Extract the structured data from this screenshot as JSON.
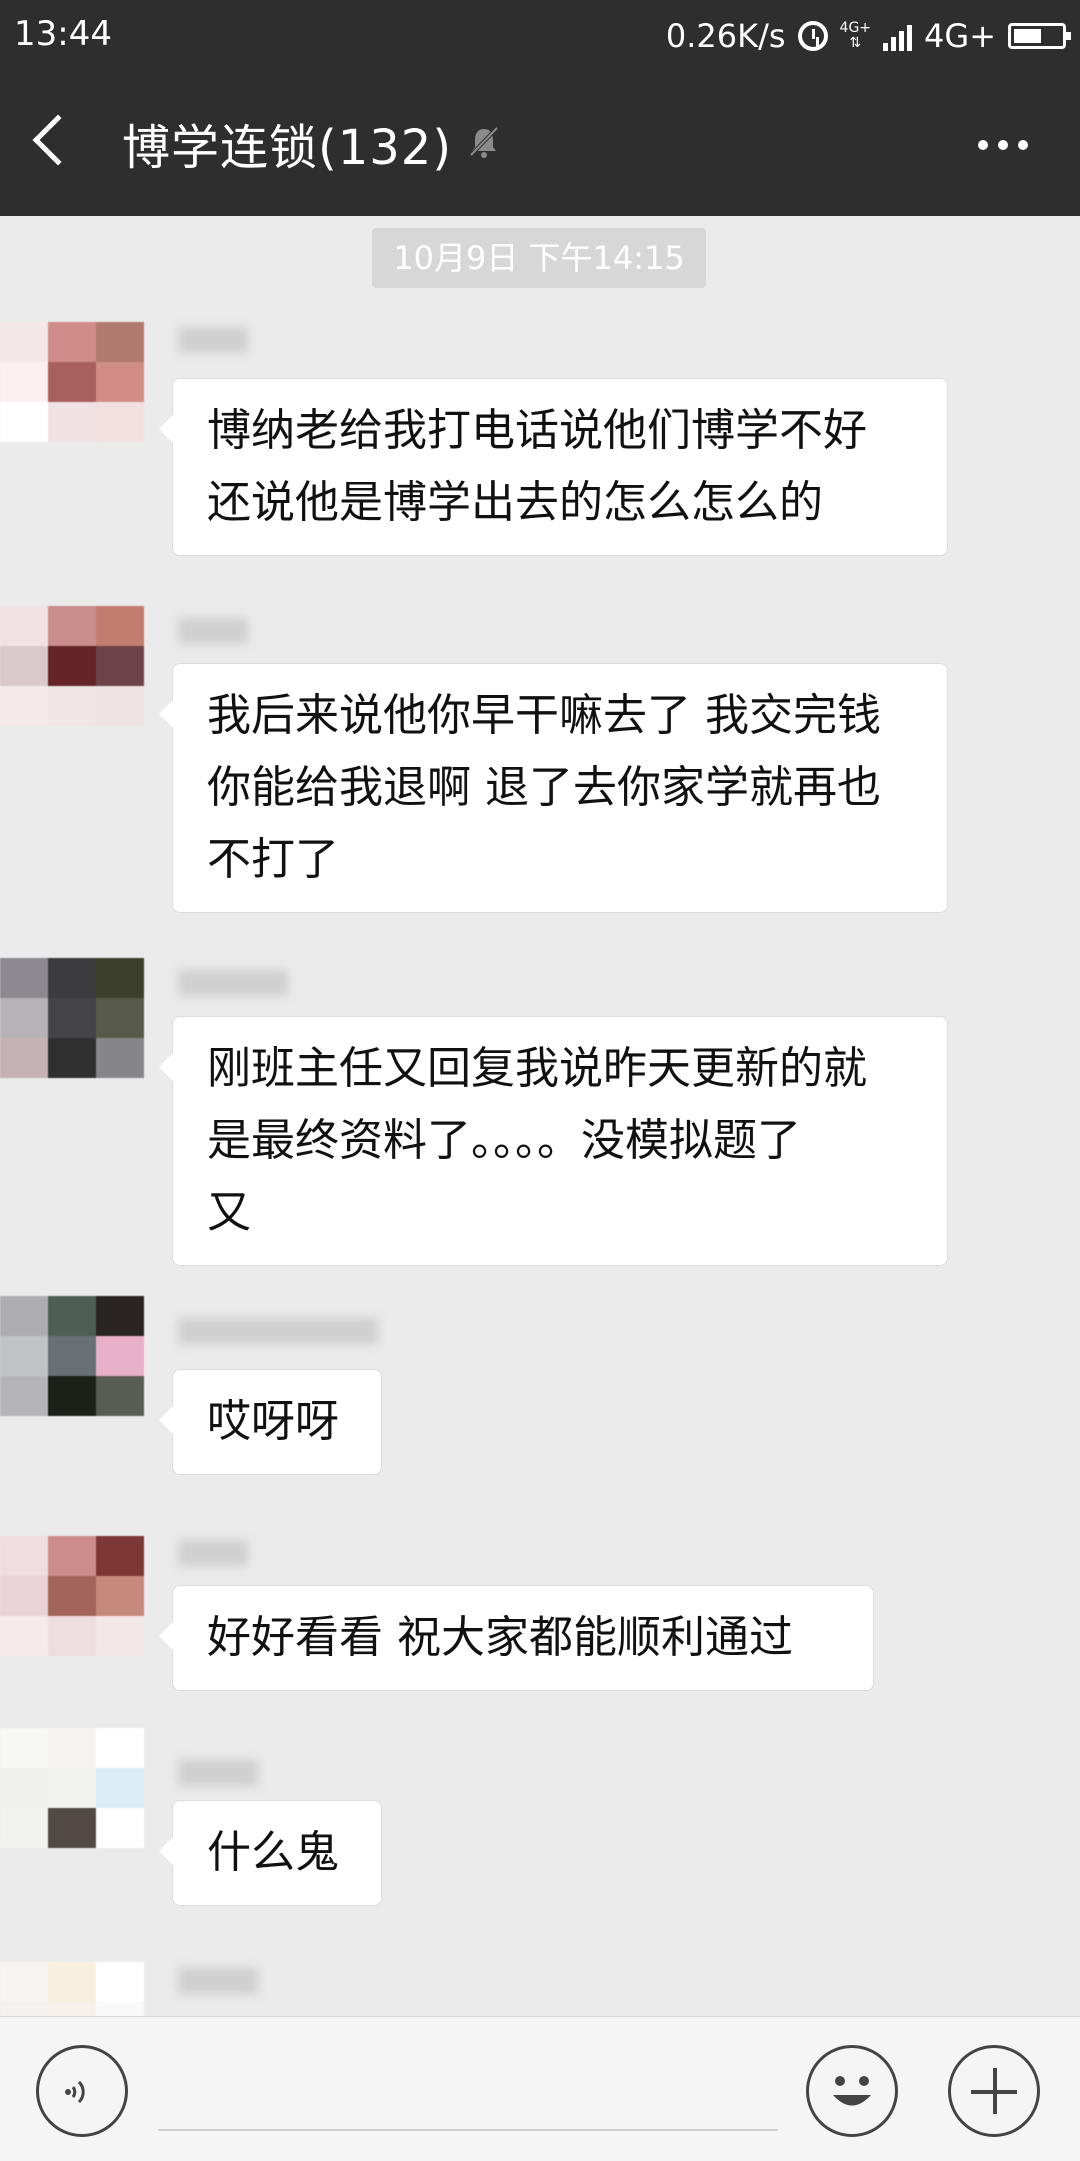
{
  "status_bar": {
    "time": "13:44",
    "net_speed": "0.26K/s",
    "net_type_small": "4G+",
    "network": "4G+"
  },
  "header": {
    "title": "博学连锁(132)",
    "icons": [
      "back-icon",
      "mute-icon",
      "more-icon"
    ]
  },
  "chat": {
    "timestamp": "10月9日 下午14:15",
    "messages": [
      {
        "lines": [
          "博纳老给我打电话说他们博学不好",
          "还说他是博学出去的怎么怎么的"
        ],
        "avatar_colors": [
          "#f4e7e9",
          "#cf8c88",
          "#b07a6f",
          "#fbeff1",
          "#a7605c",
          "#d28e86",
          "#ffffff",
          "#f0e2e4",
          "#f3dfe0"
        ]
      },
      {
        "lines": [
          "我后来说他你早干嘛去了 我交完钱",
          "你能给我退啊 退了去你家学就再也",
          "不打了"
        ],
        "avatar_colors": [
          "#f2e2e4",
          "#c98d8b",
          "#c27d70",
          "#d9c9cc",
          "#642426",
          "#6d4348",
          "#f4eaea",
          "#efe6e6",
          "#eee4e4"
        ]
      },
      {
        "lines": [
          "刚班主任又回复我说昨天更新的就",
          "是最终资料了。。。。没模拟题了",
          "又"
        ],
        "avatar_colors": [
          "#8d8890",
          "#3b3b3d",
          "#3c3f2a",
          "#b7b2b6",
          "#444447",
          "#575a49",
          "#c6b1b4",
          "#2f2f30",
          "#868689"
        ]
      },
      {
        "lines": [
          "哎呀呀"
        ],
        "avatar_colors": [
          "#adadb0",
          "#4f5d57",
          "#2a2424",
          "#c0c2c4",
          "#687074",
          "#e9b1c9",
          "#b5b5b7",
          "#1d2019",
          "#595c55"
        ]
      },
      {
        "lines": [
          "好好看看 祝大家都能顺利通过"
        ],
        "avatar_colors": [
          "#f0dde0",
          "#cc8d8a",
          "#7d3835",
          "#ead2d6",
          "#a3655b",
          "#c6897d",
          "#f6eaec",
          "#efdedf",
          "#f4e7e7"
        ]
      },
      {
        "lines": [
          "什么鬼"
        ],
        "avatar_colors": [
          "#f7f7f5",
          "#f4f3ef",
          "#ffffff",
          "#f0f0ec",
          "#f2f3ef",
          "#dcedf6",
          "#f2f2f0",
          "#504a43",
          "#ffffff"
        ]
      },
      {
        "lines": [],
        "avatar_colors": [
          "#f7f5f3",
          "#f8efdf",
          "#ffffff",
          "#f4f1ee",
          "#f6f2ea",
          "#f9f9f9",
          "#efefef",
          "#efefef",
          "#efefef"
        ]
      }
    ]
  },
  "input_bar": {
    "icons": [
      "voice-icon",
      "emoji-icon",
      "plus-icon"
    ]
  }
}
